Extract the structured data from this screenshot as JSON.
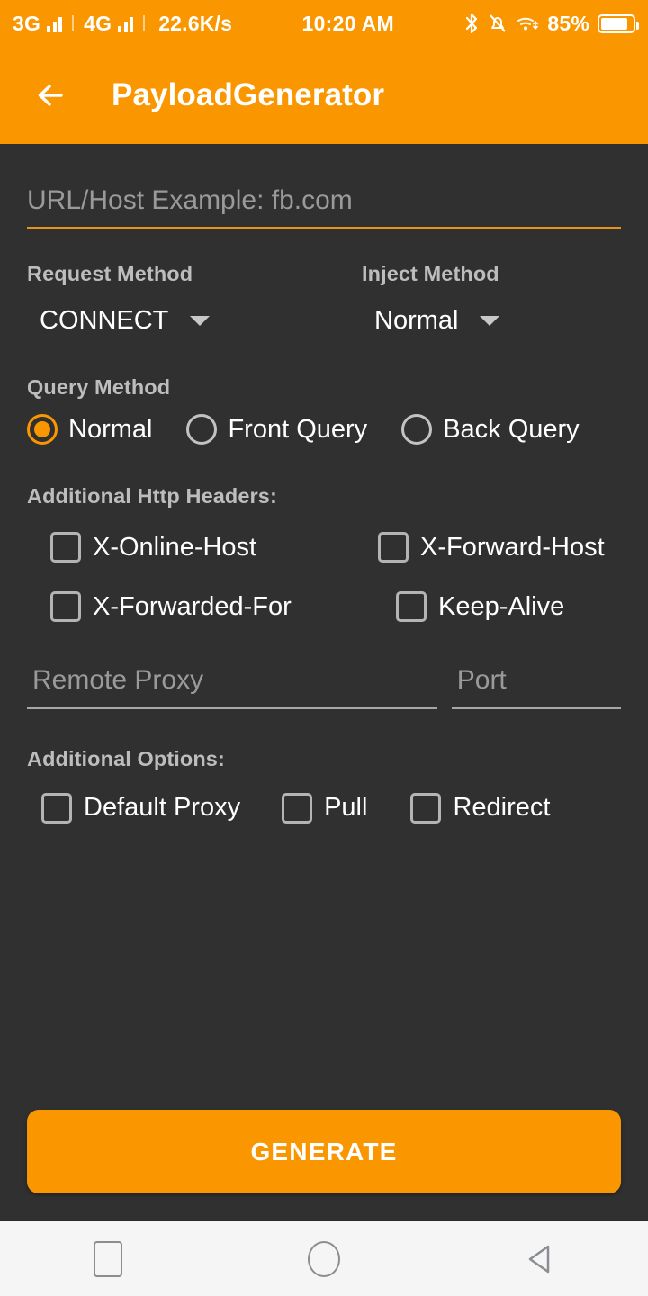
{
  "status_bar": {
    "network_1": "3G",
    "network_2": "4G",
    "data_speed": "22.6K/s",
    "clock": "10:20 AM",
    "battery_percent": "85%",
    "icons": [
      "signal-bars-icon",
      "signal-bars-icon",
      "bluetooth-icon",
      "notification-off-icon",
      "wifi-icon",
      "battery-icon"
    ],
    "bluetooth_glyph": "ᛒ",
    "background_color": "#FA9600"
  },
  "app_bar": {
    "back_label": "back-arrow-icon",
    "title": "PayloadGenerator",
    "background_color": "#FA9600"
  },
  "url": {
    "placeholder": "URL/Host Example: fb.com",
    "value": "",
    "underline_color": "#E8911A"
  },
  "request_method": {
    "label": "Request Method",
    "selected": "CONNECT",
    "options": [
      "CONNECT"
    ]
  },
  "inject_method": {
    "label": "Inject Method",
    "selected": "Normal",
    "options": [
      "Normal"
    ]
  },
  "query_method": {
    "label": "Query Method",
    "options": [
      {
        "label": "Normal",
        "checked": true
      },
      {
        "label": "Front Query",
        "checked": false
      },
      {
        "label": "Back Query",
        "checked": false
      }
    ]
  },
  "http_headers": {
    "label": "Additional Http Headers:",
    "options": [
      {
        "label": "X-Online-Host",
        "checked": false
      },
      {
        "label": "X-Forward-Host",
        "checked": false
      },
      {
        "label": "X-Forwarded-For",
        "checked": false
      },
      {
        "label": "Keep-Alive",
        "checked": false
      }
    ]
  },
  "proxy": {
    "remote_placeholder": "Remote Proxy",
    "remote_value": "",
    "port_placeholder": "Port",
    "port_value": ""
  },
  "additional_options": {
    "label": "Additional Options:",
    "options": [
      {
        "label": "Default Proxy",
        "checked": false
      },
      {
        "label": "Pull",
        "checked": false
      },
      {
        "label": "Redirect",
        "checked": false
      }
    ]
  },
  "generate": {
    "label": "GENERATE",
    "color": "#FA9600"
  },
  "nav_bar": {
    "recents": "square-icon",
    "home": "circle-icon",
    "back": "triangle-back-icon",
    "background_color": "#F5F5F5"
  },
  "theme": {
    "accent": "#FA9600",
    "background": "#303030",
    "label_color": "#BDBDBD",
    "text_color": "#FFFFFF",
    "placeholder_color": "#9A9A9A"
  }
}
